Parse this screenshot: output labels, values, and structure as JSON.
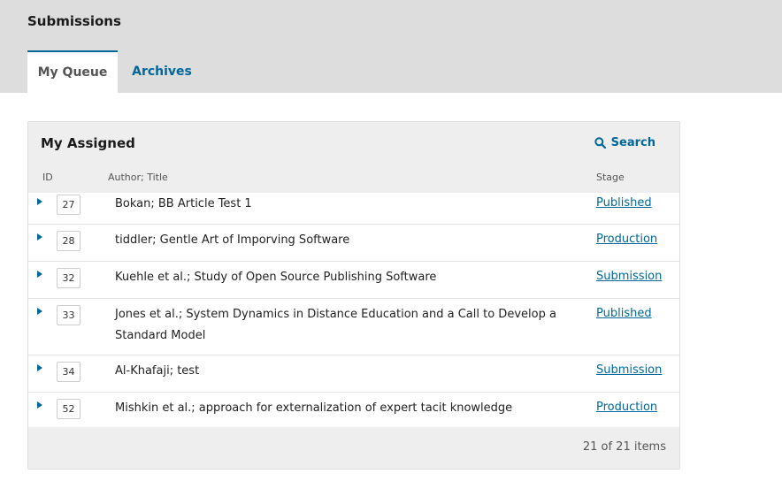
{
  "header": {
    "title": "Submissions"
  },
  "tabs": [
    {
      "label": "My Queue"
    },
    {
      "label": "Archives"
    }
  ],
  "panel": {
    "title": "My Assigned",
    "search_label": "Search",
    "columns": {
      "id": "ID",
      "title": "Author; Title",
      "stage": "Stage"
    },
    "rows": [
      {
        "id": "27",
        "title": "Bokan; BB Article Test 1",
        "stage": "Published"
      },
      {
        "id": "28",
        "title": "tiddler; Gentle Art of Imporving Software",
        "stage": "Production"
      },
      {
        "id": "32",
        "title": "Kuehle et al.; Study of Open Source Publishing Software",
        "stage": "Submission"
      },
      {
        "id": "33",
        "title": "Jones et al.; System Dynamics in Distance Education and a Call to Develop a Standard Model",
        "stage": "Published"
      },
      {
        "id": "34",
        "title": "Al-Khafaji; test",
        "stage": "Submission"
      },
      {
        "id": "52",
        "title": "Mishkin et al.; approach for externalization of expert tacit knowledge",
        "stage": "Production"
      }
    ],
    "count_text": "21 of 21 items"
  },
  "colors": {
    "accent": "#006798",
    "header_bg": "#dddddd",
    "panel_bg": "#eeeeee"
  },
  "icons": {
    "search": "search-icon",
    "expand": "expand-arrow-icon"
  }
}
